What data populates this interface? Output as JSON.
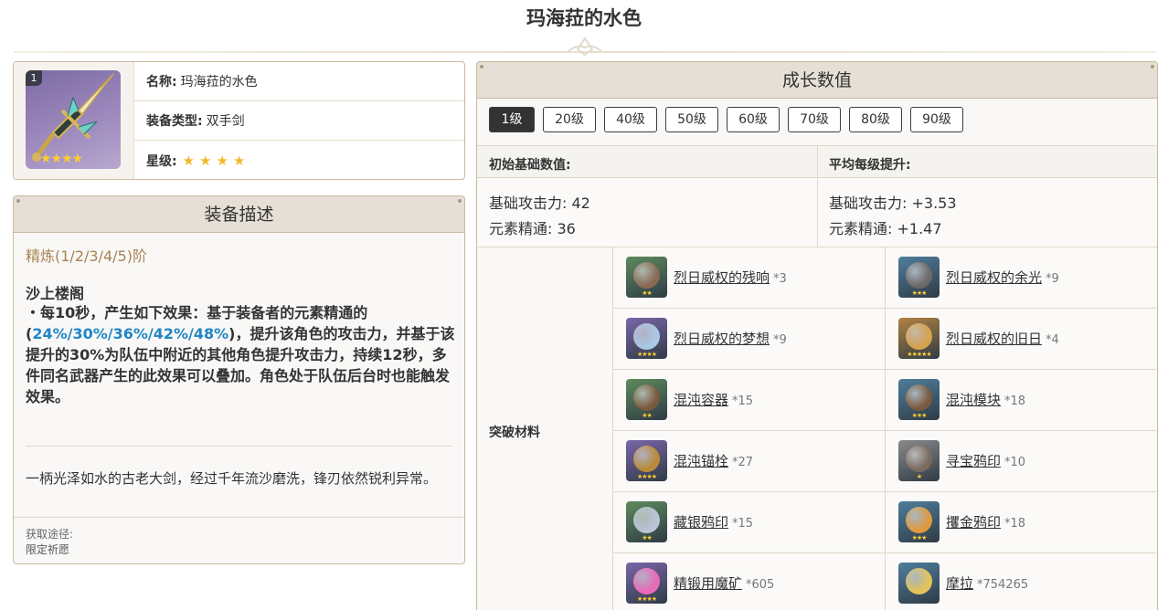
{
  "page": {
    "title": "玛海菈的水色"
  },
  "info": {
    "refinement_badge": "1",
    "name_key": "名称:",
    "name_value": "玛海菈的水色",
    "type_key": "装备类型:",
    "type_value": "双手剑",
    "rarity_key": "星级:",
    "rarity_stars": "★★★★",
    "icon_stars": "★★★★"
  },
  "description": {
    "header": "装备描述",
    "refine_label": "精炼(1/2/3/4/5)阶",
    "passive_name": "沙上楼阁",
    "passive_part1": "・每10秒，产生如下效果：基于装备者的元素精通的(",
    "passive_values": "24%/30%/36%/42%/48%",
    "passive_part2": ")，提升该角色的攻击力，并基于该提升的30%为队伍中附近的其他角色提升攻击力，持续12秒，多件同名武器产生的此效果可以叠加。角色处于队伍后台时也能触发效果。",
    "flavor": "一柄光泽如水的古老大剑，经过千年流沙磨洗，锋刃依然锐利异常。",
    "obtain_label": "获取途径:",
    "obtain_value": "限定祈愿"
  },
  "growth": {
    "header": "成长数值",
    "levels": [
      "1级",
      "20级",
      "40级",
      "50级",
      "60级",
      "70级",
      "80级",
      "90级"
    ],
    "active_level": "1级",
    "base_title": "初始基础数值:",
    "base_atk": "基础攻击力: 42",
    "base_em": "元素精通: 36",
    "avg_title": "平均每级提升:",
    "avg_atk": "基础攻击力: +3.53",
    "avg_em": "元素精通: +1.47",
    "materials_label": "突破材料",
    "materials": [
      {
        "name": "烈日威权的残响",
        "count": "*3",
        "stars": "★★",
        "icon": "relic-mask-icon",
        "bg": "#5e8a5c",
        "orb": "#8a6a55"
      },
      {
        "name": "烈日威权的余光",
        "count": "*9",
        "stars": "★★★",
        "icon": "relic-mask-icon",
        "bg": "#4f7e9c",
        "orb": "#6d6a6a"
      },
      {
        "name": "烈日威权的梦想",
        "count": "*9",
        "stars": "★★★★",
        "icon": "relic-mask-icon",
        "bg": "#7a66a8",
        "orb": "#a9c9e6"
      },
      {
        "name": "烈日威权的旧日",
        "count": "*4",
        "stars": "★★★★★",
        "icon": "relic-mask-icon",
        "bg": "#b38240",
        "orb": "#d6a24e"
      },
      {
        "name": "混沌容器",
        "count": "*15",
        "stars": "★★",
        "icon": "chaos-device-icon",
        "bg": "#5e8a5c",
        "orb": "#7a5a3e"
      },
      {
        "name": "混沌模块",
        "count": "*18",
        "stars": "★★★",
        "icon": "chaos-device-icon",
        "bg": "#4f7e9c",
        "orb": "#7a5a3e"
      },
      {
        "name": "混沌锚栓",
        "count": "*27",
        "stars": "★★★★",
        "icon": "chaos-device-icon",
        "bg": "#7a66a8",
        "orb": "#b88a3a"
      },
      {
        "name": "寻宝鸦印",
        "count": "*10",
        "stars": "★",
        "icon": "crow-insignia-icon",
        "bg": "#8a8a8a",
        "orb": "#7a6a5e"
      },
      {
        "name": "藏银鸦印",
        "count": "*15",
        "stars": "★★",
        "icon": "crow-insignia-icon",
        "bg": "#5e8a5c",
        "orb": "#b9c3d6"
      },
      {
        "name": "攫金鸦印",
        "count": "*18",
        "stars": "★★★",
        "icon": "crow-insignia-icon",
        "bg": "#4f7e9c",
        "orb": "#e09a3c"
      },
      {
        "name": "精锻用魔矿",
        "count": "*605",
        "stars": "★★★★",
        "icon": "mystic-ore-icon",
        "bg": "#7a66a8",
        "orb": "#e86ab8"
      },
      {
        "name": "摩拉",
        "count": "*754265",
        "stars": "",
        "icon": "mora-coin-icon",
        "bg": "#4f7e9c",
        "orb": "#e3c35a"
      }
    ]
  }
}
